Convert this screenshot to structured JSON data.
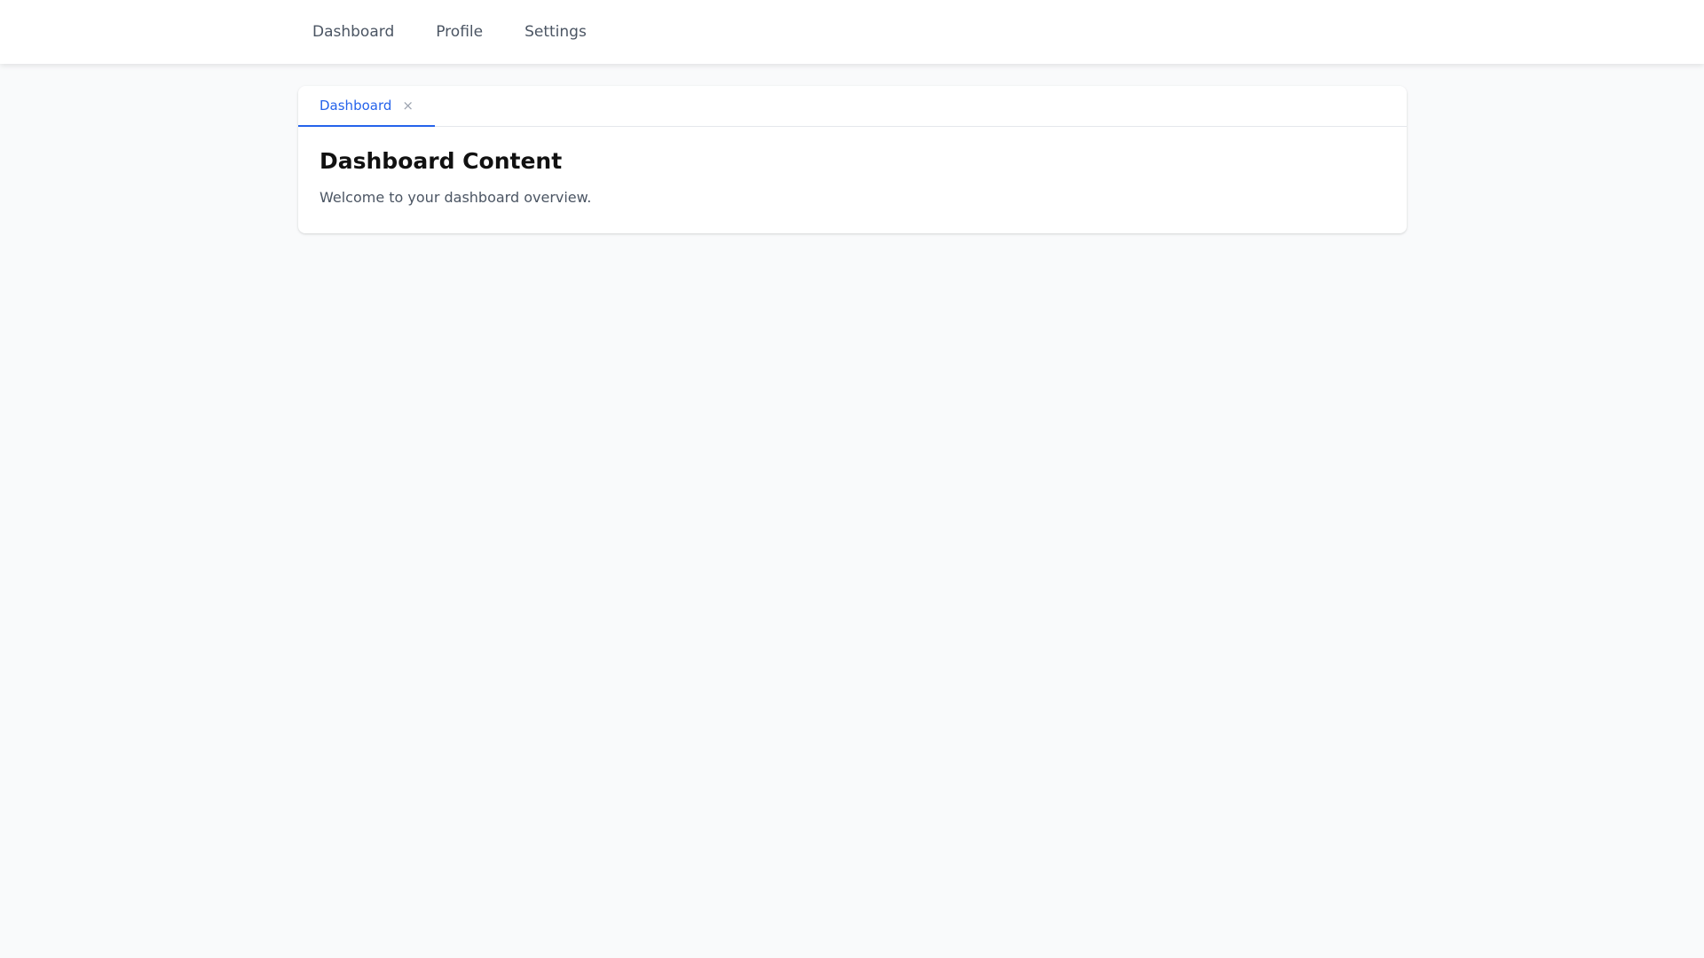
{
  "nav": {
    "items": [
      {
        "label": "Dashboard"
      },
      {
        "label": "Profile"
      },
      {
        "label": "Settings"
      }
    ]
  },
  "tabs": [
    {
      "label": "Dashboard",
      "active": true,
      "close_icon": "×"
    }
  ],
  "content": {
    "title": "Dashboard Content",
    "text": "Welcome to your dashboard overview."
  },
  "colors": {
    "accent": "#2563eb",
    "background": "#f9fafb",
    "nav_text": "#4b5563"
  }
}
